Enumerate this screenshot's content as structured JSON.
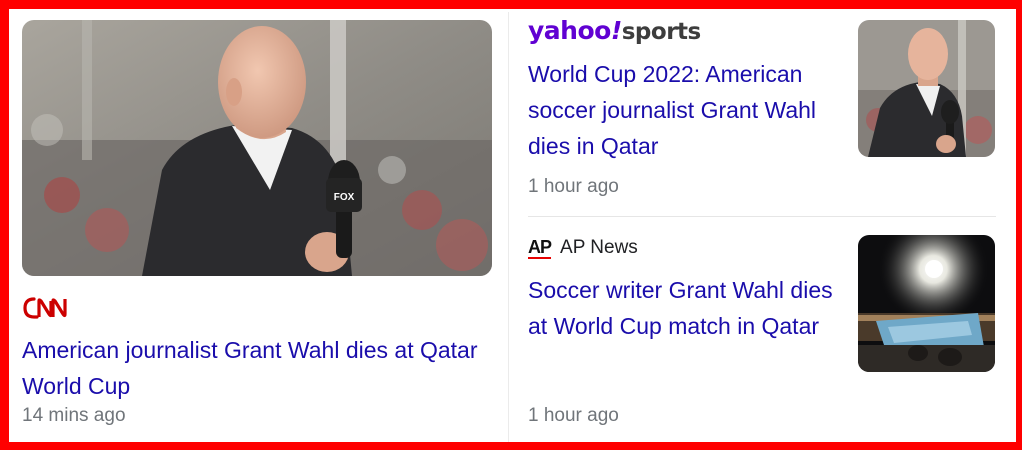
{
  "lead": {
    "source": "CNN",
    "title": "American journalist Grant Wahl dies at Qatar World Cup",
    "time": "14 mins ago",
    "mic_flag_text": "FOX"
  },
  "stories": [
    {
      "source_part1": "yahoo",
      "source_part2": "!",
      "source_part3": "sports",
      "title": "World Cup 2022: American soccer journalist Grant Wahl dies in Qatar",
      "time": "1 hour ago"
    },
    {
      "source_logo": "AP",
      "source_name": "AP News",
      "title": "Soccer writer Grant Wahl dies at World Cup match in Qatar",
      "time": "1 hour ago"
    }
  ],
  "colors": {
    "frame": "#ff0000",
    "link": "#1a0dab",
    "meta": "#70757a",
    "yahoo": "#6001d2",
    "cnn": "#cc0000"
  },
  "icons": {
    "cnn": "cnn-logo-icon",
    "yahoo": "yahoo-sports-logo",
    "ap": "ap-logo-icon"
  }
}
